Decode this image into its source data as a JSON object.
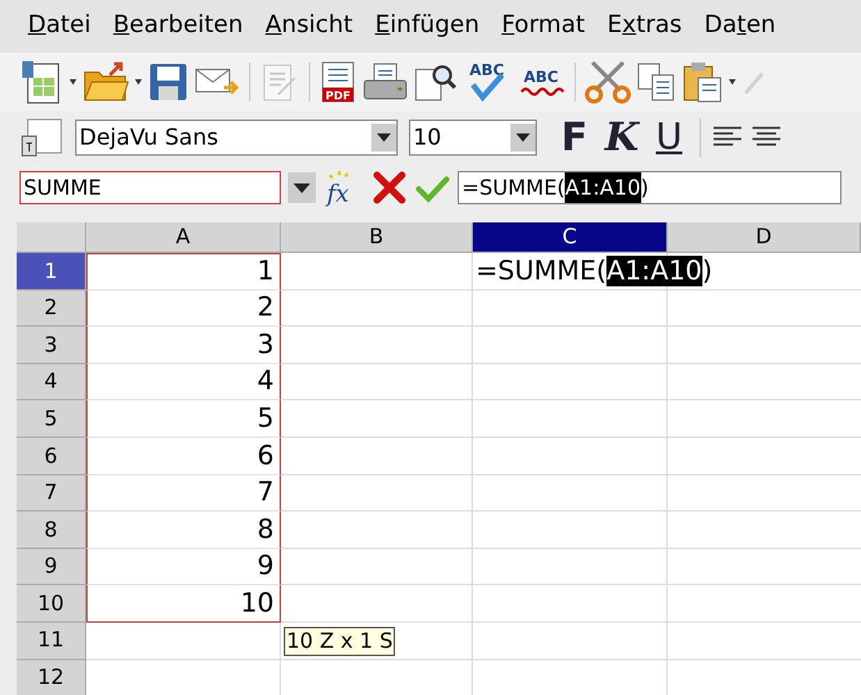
{
  "menu": [
    {
      "key": "D",
      "post": "atei"
    },
    {
      "key": "B",
      "post": "earbeiten"
    },
    {
      "key": "A",
      "post": "nsicht"
    },
    {
      "key": "E",
      "post": "infügen"
    },
    {
      "key": "F",
      "post": "ormat"
    },
    {
      "pre": "E",
      "key": "x",
      "post": "tras"
    },
    {
      "pre": "Da",
      "key": "t",
      "post": "en"
    }
  ],
  "standard_toolbar": {
    "pdf_label": "PDF",
    "spellcheck_label": "ABC",
    "autospell_label": "ABC"
  },
  "format_toolbar": {
    "font_name": "DejaVu Sans",
    "font_size": "10",
    "bold": "F",
    "italic": "K",
    "underline": "U"
  },
  "formula_bar": {
    "name_box": "SUMME",
    "function_wizard_label": "fx",
    "formula": [
      {
        "text": "=SUMME(",
        "highlighted": false
      },
      {
        "text": "A1:A10",
        "highlighted": true
      },
      {
        "text": ")",
        "highlighted": false
      }
    ]
  },
  "sheet": {
    "columns": [
      {
        "label": "A",
        "selected": false
      },
      {
        "label": "B",
        "selected": false
      },
      {
        "label": "C",
        "selected": true
      },
      {
        "label": "D",
        "selected": false
      }
    ],
    "rows": [
      {
        "label": "1",
        "selected": true,
        "in_range": true,
        "a": "1",
        "c": [
          {
            "text": "=SUMME(",
            "highlighted": false
          },
          {
            "text": "A1:A10",
            "highlighted": true
          },
          {
            "text": ")",
            "highlighted": false
          }
        ]
      },
      {
        "label": "2",
        "selected": false,
        "in_range": true,
        "a": "2"
      },
      {
        "label": "3",
        "selected": false,
        "in_range": true,
        "a": "3"
      },
      {
        "label": "4",
        "selected": false,
        "in_range": true,
        "a": "4"
      },
      {
        "label": "5",
        "selected": false,
        "in_range": true,
        "a": "5"
      },
      {
        "label": "6",
        "selected": false,
        "in_range": true,
        "a": "6"
      },
      {
        "label": "7",
        "selected": false,
        "in_range": true,
        "a": "7"
      },
      {
        "label": "8",
        "selected": false,
        "in_range": true,
        "a": "8"
      },
      {
        "label": "9",
        "selected": false,
        "in_range": true,
        "a": "9"
      },
      {
        "label": "10",
        "selected": false,
        "in_range": true,
        "a": "10"
      },
      {
        "label": "11",
        "selected": false,
        "in_range": false,
        "b_tooltip": "10 Z x 1 S"
      },
      {
        "label": "12",
        "selected": false,
        "in_range": false
      }
    ]
  }
}
